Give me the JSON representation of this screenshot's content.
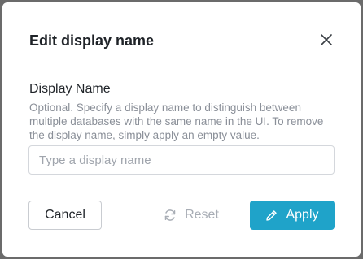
{
  "dialog": {
    "title": "Edit display name",
    "close_icon": "close-icon"
  },
  "field": {
    "label": "Display Name",
    "help": "Optional. Specify a display name to distinguish between multiple databases with the same name in the UI. To remove the display name, simply apply an empty value.",
    "value": "",
    "placeholder": "Type a display name"
  },
  "actions": {
    "cancel_label": "Cancel",
    "reset_label": "Reset",
    "reset_icon": "refresh-icon",
    "apply_label": "Apply",
    "apply_icon": "pencil-icon"
  },
  "colors": {
    "accent": "#1fa3c9",
    "disabled_text": "#a8adb5",
    "help_text": "#8a8f98"
  }
}
